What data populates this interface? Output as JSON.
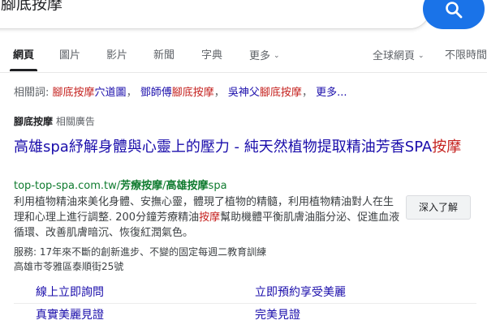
{
  "search": {
    "query": "腳底按摩"
  },
  "tabs": {
    "items": [
      "網頁",
      "圖片",
      "影片",
      "新聞",
      "字典",
      "更多"
    ],
    "active": "網頁",
    "region_filter": "全球網頁",
    "time_filter": "不限時間"
  },
  "related": {
    "label": "相關詞:",
    "items": [
      {
        "hl": "腳底按摩",
        "rest": "穴道圖"
      },
      {
        "pre": "鄧師傅",
        "hl": "腳底按摩"
      },
      {
        "pre": "吳神父",
        "hl": "腳底按摩"
      }
    ],
    "more": "更多..."
  },
  "ad": {
    "header_query": "腳底按摩",
    "header_label": "相關廣告",
    "title_main": "高雄spa紓解身體與心靈上的壓力 - 純天然植物提取精油芳香SPA",
    "title_hl": "按摩",
    "url_pre": "top-top-spa.com.tw/",
    "url_b1": "芳療按摩",
    "url_mid": "/",
    "url_b2": "高雄按摩",
    "url_post": "spa",
    "desc_1": "利用植物精油來美化身體、安撫心靈，體現了植物的精髓，利用植物精油對人在生理和心理上進行調整. 200分鐘芳療精油",
    "desc_hl": "按摩",
    "desc_2": "幫助機體平衡肌膚油脂分泌、促進血液循環、改善肌膚暗沉、恢復紅潤氣色。",
    "more_button": "深入了解",
    "service": "服務: 17年來不斷的創新進步、不變的固定每週二教育訓練",
    "address": "高雄市苓雅區泰順街25號",
    "sitelinks": [
      "線上立即詢問",
      "立即預約享受美麗",
      "真實美麗見證",
      "完美見證"
    ]
  },
  "colors": {
    "link": "#1a0dab",
    "highlight": "#c5221f",
    "url": "#0f7b2f",
    "search_button": "#1a73e8"
  }
}
